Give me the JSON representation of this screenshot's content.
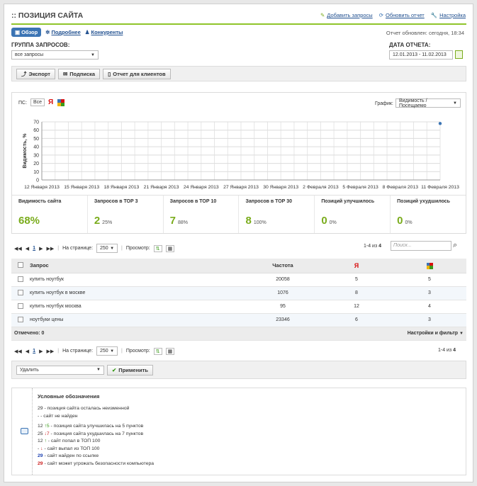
{
  "header": {
    "title": ":: ПОЗИЦИЯ САЙТА",
    "links": [
      "Добавить запросы",
      "Обновить отчет",
      "Настройка"
    ]
  },
  "tabs": [
    "Обзор",
    "Подробнее",
    "Конкуренты"
  ],
  "updated": "Отчет обновлен: сегодня, 18:34",
  "group": {
    "label": "ГРУППА ЗАПРОСОВ:",
    "value": "все запросы"
  },
  "date": {
    "label": "ДАТА ОТЧЕТА:",
    "value": "12.01.2013 - 11.02.2013"
  },
  "toolbar": {
    "export": "Экспорт",
    "subscribe": "Подписка",
    "client_report": "Отчет для клиентов"
  },
  "chart": {
    "ps_label": "ПС:",
    "ps_all": "Все",
    "yandex": "Я",
    "graph_label": "График:",
    "graph_value": "Видимость / Посещаемо"
  },
  "chart_data": {
    "type": "line",
    "ylabel": "Видимость, %",
    "ylim": [
      0,
      70
    ],
    "yticks": [
      0,
      10,
      20,
      30,
      40,
      50,
      60,
      70
    ],
    "x_labels": [
      "12 Января 2013",
      "15 Января 2013",
      "18 Января 2013",
      "21 Января 2013",
      "24 Января 2013",
      "27 Января 2013",
      "30 Января 2013",
      "2 Февраля 2013",
      "5 Февраля 2013",
      "8 Февраля 2013",
      "11 Февраля 2013"
    ],
    "series": [
      {
        "x": [
          "11 Февраля 2013"
        ],
        "values": [
          68
        ]
      }
    ],
    "grid": true
  },
  "stats": [
    {
      "label": "Видимость сайта",
      "value": "68%",
      "pct": ""
    },
    {
      "label": "Запросов в ТОР 3",
      "value": "2",
      "pct": "25%"
    },
    {
      "label": "Запросов в ТОР 10",
      "value": "7",
      "pct": "88%"
    },
    {
      "label": "Запросов в ТОР 30",
      "value": "8",
      "pct": "100%"
    },
    {
      "label": "Позиций улучшилось",
      "value": "0",
      "pct": "0%"
    },
    {
      "label": "Позиций ухудшилось",
      "value": "0",
      "pct": "0%"
    }
  ],
  "pager": {
    "page": "1",
    "per_page_label": "На странице:",
    "per_page": "250",
    "view_label": "Просмотр:",
    "range": "1-4 из",
    "total": "4",
    "search_placeholder": "Поиск..."
  },
  "table": {
    "headers": [
      "Запрос",
      "Частота",
      "Я",
      ""
    ],
    "rows": [
      {
        "query": "купить ноутбук",
        "freq": "20058",
        "y": "5",
        "g": "5"
      },
      {
        "query": "купить ноутбук в москве",
        "freq": "1076",
        "y": "8",
        "g": "3"
      },
      {
        "query": "купить ноутбук москва",
        "freq": "95",
        "y": "12",
        "g": "4"
      },
      {
        "query": "ноутбуки цены",
        "freq": "23346",
        "y": "6",
        "g": "3"
      }
    ],
    "marked": "Отмечено: 0",
    "settings": "Настройки и фильтр"
  },
  "actions": {
    "delete": "Удалить",
    "apply": "Применить"
  },
  "legend": {
    "title": "Условные обозначения",
    "items": [
      {
        "sym": "29",
        "sym_color": "#333",
        "arrow": "",
        "arrow_color": "",
        "text": " - позиция сайта осталась неизменной"
      },
      {
        "sym": "-",
        "sym_color": "#333",
        "arrow": "",
        "arrow_color": "",
        "text": " - сайт не найден"
      },
      {
        "sym": "12",
        "sym_color": "#333",
        "arrow": "↑5",
        "arrow_color": "#3a9a1a",
        "text": " - позиция сайта улучшилась на 5 пунктов"
      },
      {
        "sym": "25",
        "sym_color": "#333",
        "arrow": "↓7",
        "arrow_color": "#cc2020",
        "text": " - позиция сайта ухудшилась на 7 пунктов"
      },
      {
        "sym": "12",
        "sym_color": "#333",
        "arrow": "↑",
        "arrow_color": "#3a9a1a",
        "text": " - сайт попал в ТОП 100"
      },
      {
        "sym": "-",
        "sym_color": "#333",
        "arrow": "↓",
        "arrow_color": "#cc2020",
        "text": " - сайт выпал из ТОП 100"
      },
      {
        "sym": "29",
        "sym_color": "#1a3fb0",
        "arrow": "",
        "arrow_color": "",
        "text": " - сайт найден по ссылке"
      },
      {
        "sym": "29",
        "sym_color": "#cc2020",
        "arrow": "",
        "arrow_color": "",
        "text": " - сайт может угрожать безопасности компьютера"
      }
    ]
  }
}
